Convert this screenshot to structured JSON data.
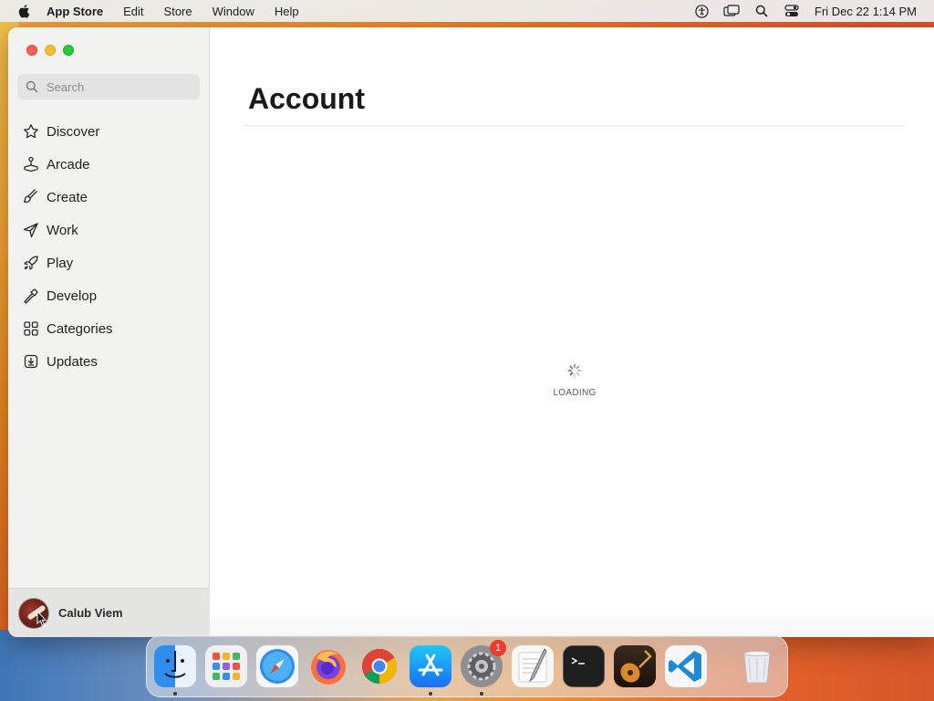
{
  "menubar": {
    "app_name": "App Store",
    "items": [
      "Edit",
      "Store",
      "Window",
      "Help"
    ],
    "clock": "Fri Dec 22  1:14 PM"
  },
  "sidebar": {
    "search_placeholder": "Search",
    "items": [
      {
        "label": "Discover",
        "icon": "star-icon"
      },
      {
        "label": "Arcade",
        "icon": "joystick-icon"
      },
      {
        "label": "Create",
        "icon": "brush-icon"
      },
      {
        "label": "Work",
        "icon": "paperplane-icon"
      },
      {
        "label": "Play",
        "icon": "rocket-icon"
      },
      {
        "label": "Develop",
        "icon": "hammer-icon"
      },
      {
        "label": "Categories",
        "icon": "grid-icon"
      },
      {
        "label": "Updates",
        "icon": "download-icon"
      }
    ],
    "account_name": "Calub Viem"
  },
  "main": {
    "title": "Account",
    "loading_text": "LOADING"
  },
  "dock": {
    "apps": [
      "Finder",
      "Launchpad",
      "Safari",
      "Firefox",
      "Chrome",
      "App Store",
      "System Settings",
      "TextEdit",
      "Terminal",
      "GarageBand",
      "VS Code",
      "Trash"
    ],
    "settings_badge": "1"
  },
  "colors": {
    "close": "#fe5f57",
    "minimize": "#febc2e",
    "maximize": "#28c840",
    "badge": "#f23a2e"
  }
}
